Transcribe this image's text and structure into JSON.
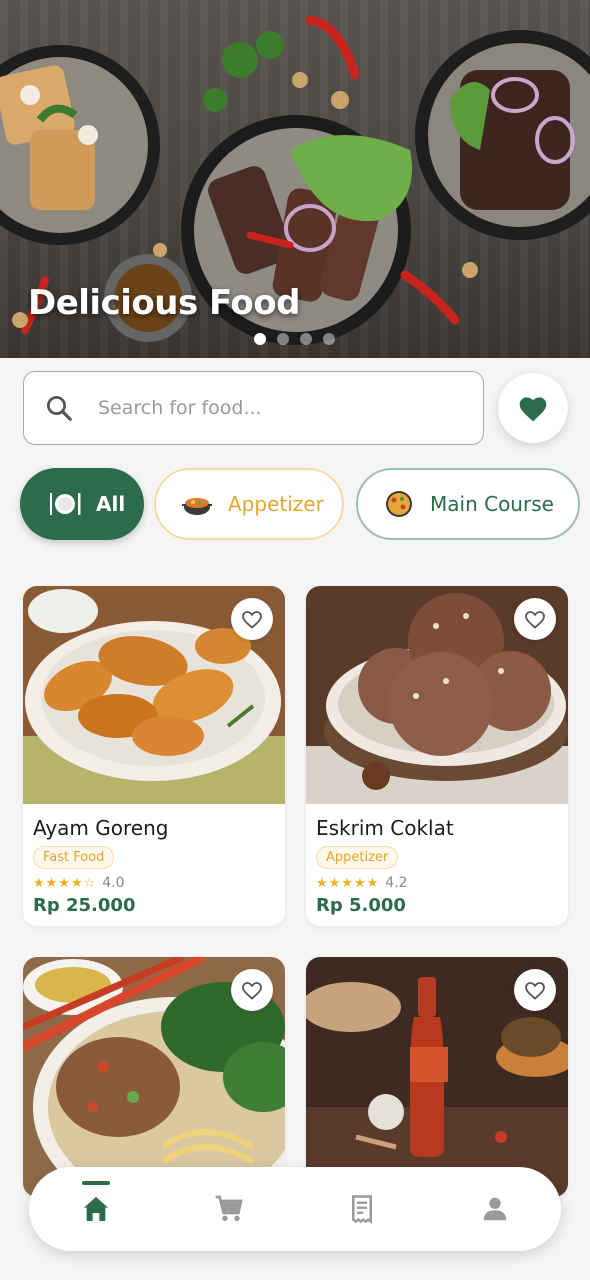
{
  "hero": {
    "title": "Delicious Food",
    "carousel": {
      "count": 4,
      "active_index": 0
    }
  },
  "search": {
    "placeholder": "Search for food..."
  },
  "categories": [
    {
      "label": "All",
      "selected": true
    },
    {
      "label": "Appetizer",
      "selected": false
    },
    {
      "label": "Main Course",
      "selected": false
    }
  ],
  "foods": [
    {
      "name": "Ayam Goreng",
      "tag": "Fast Food",
      "stars": "★★★★☆",
      "rating": "4.0",
      "price": "Rp 25.000"
    },
    {
      "name": "Eskrim Coklat",
      "tag": "Appetizer",
      "stars": "★★★★★",
      "rating": "4.2",
      "price": "Rp 5.000"
    }
  ],
  "colors": {
    "primary": "#2c6b4b",
    "accent": "#e3a632",
    "star": "#f2b01e",
    "background": "#f5f5f5"
  },
  "nav": {
    "items": [
      {
        "icon": "home-icon",
        "active": true
      },
      {
        "icon": "cart-icon",
        "active": false
      },
      {
        "icon": "receipt-icon",
        "active": false
      },
      {
        "icon": "person-icon",
        "active": false
      }
    ]
  }
}
